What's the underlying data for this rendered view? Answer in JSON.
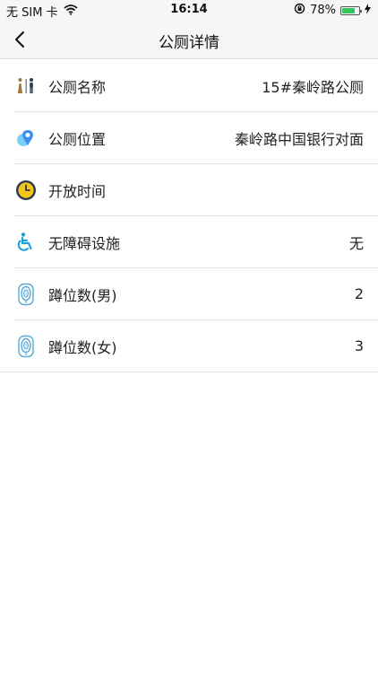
{
  "status_bar": {
    "carrier": "无 SIM 卡",
    "time": "16:14",
    "battery_percent": "78%",
    "battery_level": 0.78,
    "icons": [
      "wifi-icon",
      "orientation-lock-icon",
      "battery-icon",
      "charging-icon"
    ]
  },
  "nav": {
    "title": "公厕详情",
    "back_icon": "chevron-left-icon"
  },
  "rows": [
    {
      "icon": "toilet-icon",
      "label": "公厕名称",
      "value": "15#秦岭路公厕"
    },
    {
      "icon": "location-pin-icon",
      "label": "公厕位置",
      "value": "秦岭路中国银行对面"
    },
    {
      "icon": "clock-icon",
      "label": "开放时间",
      "value": ""
    },
    {
      "icon": "wheelchair-icon",
      "label": "无障碍设施",
      "value": "无"
    },
    {
      "icon": "squat-toilet-icon",
      "label": "蹲位数(男)",
      "value": "2"
    },
    {
      "icon": "squat-toilet-icon",
      "label": "蹲位数(女)",
      "value": "3"
    }
  ],
  "colors": {
    "bar_background": "#f6f6f6",
    "battery_green": "#34c759",
    "wheelchair_blue": "#1aa0e0",
    "clock_yellow": "#f5c518",
    "pin_blue": "#3d8ef5"
  }
}
